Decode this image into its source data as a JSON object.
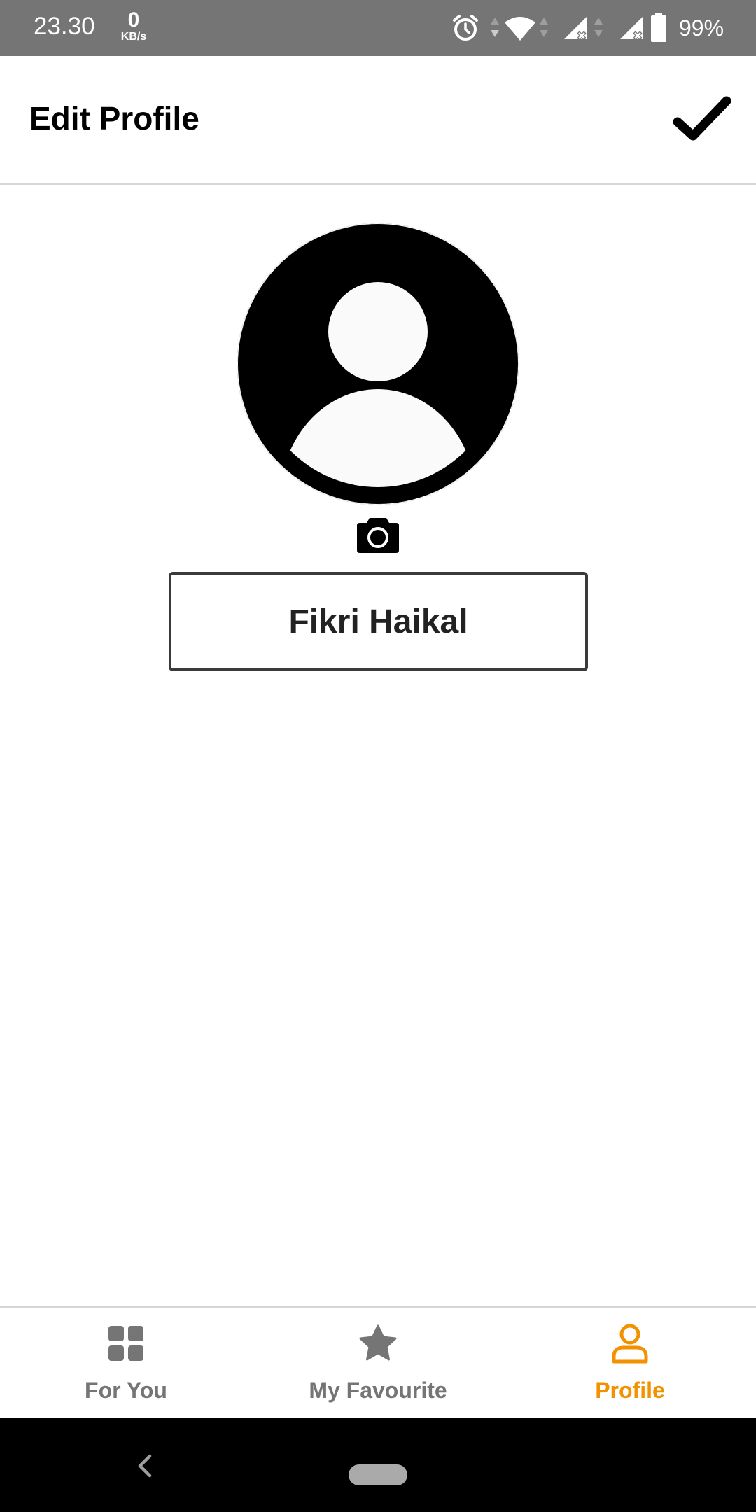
{
  "status_bar": {
    "time": "23.30",
    "net_speed_value": "0",
    "net_speed_unit": "KB/s",
    "battery_percent": "99%",
    "icons": [
      "alarm-icon",
      "wifi-icon",
      "signal-icon",
      "signal-icon",
      "battery-icon"
    ]
  },
  "header": {
    "title": "Edit Profile",
    "save_icon": "checkmark-icon"
  },
  "profile": {
    "avatar_icon": "user-avatar-icon",
    "camera_icon": "camera-icon",
    "name_value": "Fikri Haikal"
  },
  "bottom_nav": {
    "items": [
      {
        "label": "For You",
        "icon": "grid-icon",
        "active": false
      },
      {
        "label": "My Favourite",
        "icon": "star-icon",
        "active": false
      },
      {
        "label": "Profile",
        "icon": "person-icon",
        "active": true
      }
    ]
  },
  "colors": {
    "status_bar": "#757575",
    "accent": "#f39200",
    "inactive": "#757575",
    "text": "#000000"
  }
}
